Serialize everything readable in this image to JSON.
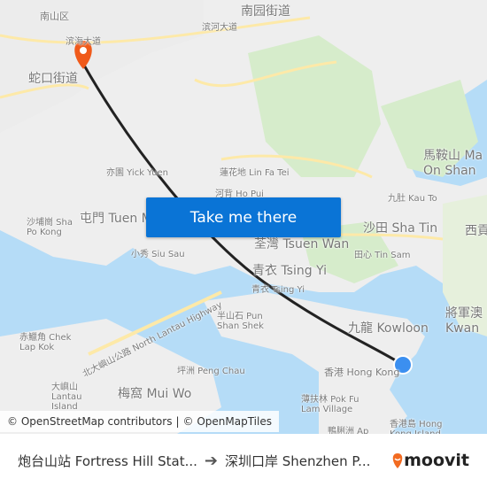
{
  "map": {
    "labels": [
      "南山区",
      "南园街道",
      "滨河大道",
      "滨海大道",
      "蛇口街道",
      "亦園 Yick Yuen",
      "蓮花地 Lin Fa Tei",
      "河背 Ho Pui",
      "馬鞍山 Ma On Shan",
      "九肚 Kau To",
      "沙埔崗 Sha Po Kong",
      "屯門 Tuen Mun",
      "小秀 Siu Sau",
      "荃灣 Tsuen Wan",
      "沙田 Sha Tin",
      "西貢",
      "田心 Tin Sam",
      "青衣 Tsing Yi",
      "青衣 Tsing Yi",
      "半山石 Pun Shan Shek",
      "九龍 Kowloon",
      "將軍澳 Kwan",
      "赤鱲角 Chek Lap Kok",
      "北大嶼山公路 North Lantau Highway",
      "坪洲 Peng Chau",
      "大嶼山 Lantau Island",
      "梅窩 Mui Wo",
      "香港 Hong Kong",
      "薄扶林 Pok Fu Lam Village",
      "香港島 Hong Kong Island",
      "鴨脷洲 Ap"
    ],
    "colors": {
      "water": "#b5dcf7",
      "land": "#eeeeee",
      "park": "#cfe8c0",
      "road": "#fde9a8",
      "route": "#222222",
      "destination_pin": "#f05a1a",
      "origin_dot": "#3b8ff0"
    },
    "destination_icon": "map-pin-icon",
    "origin_icon": "current-location-dot-icon"
  },
  "cta": {
    "label": "Take me there"
  },
  "attribution": {
    "osm": "© OpenStreetMap contributors",
    "sep": "|",
    "omt": "© OpenMapTiles"
  },
  "footer": {
    "origin": "炮台山站 Fortress Hill Stat...",
    "arrow_icon": "arrow-right-icon",
    "destination": "深圳口岸 Shenzhen P...",
    "brand": "moovit",
    "brand_color": "#f26b21"
  }
}
